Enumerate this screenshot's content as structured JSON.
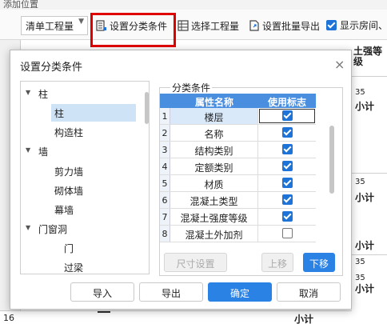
{
  "background": {
    "top_text": "添加位置",
    "toolbar": {
      "quantity_select": "清单工程量",
      "set_category_button": "设置分类条件",
      "choose_quantity_button": "选择工程量",
      "batch_export_button": "设置批量导出",
      "show_room_checkbox": "显示房间、"
    },
    "grid_right": {
      "header": "土强等级",
      "cells": [
        "35",
        "小计",
        "35",
        "小计",
        "35",
        "小计",
        "35",
        "小计"
      ]
    },
    "bottom_row": {
      "number": "16",
      "label": "小计"
    }
  },
  "dialog": {
    "title": "设置分类条件",
    "close": "×",
    "tree": [
      {
        "label": "柱",
        "level": 0,
        "expanded": true
      },
      {
        "label": "柱",
        "level": 1,
        "selected": true
      },
      {
        "label": "构造柱",
        "level": 1
      },
      {
        "label": "墙",
        "level": 0,
        "expanded": true
      },
      {
        "label": "剪力墙",
        "level": 1
      },
      {
        "label": "砌体墙",
        "level": 1
      },
      {
        "label": "幕墙",
        "level": 1
      },
      {
        "label": "门窗洞",
        "level": 0,
        "expanded": true
      },
      {
        "label": "门",
        "level": 1
      },
      {
        "label": "过梁",
        "level": 1
      }
    ],
    "group_label": "分类条件",
    "table": {
      "headers": {
        "name": "属性名称",
        "flag": "使用标志"
      },
      "rows": [
        {
          "num": "1",
          "name": "楼层",
          "checked": true,
          "selected": true
        },
        {
          "num": "2",
          "name": "名称",
          "checked": true
        },
        {
          "num": "3",
          "name": "结构类别",
          "checked": true
        },
        {
          "num": "4",
          "name": "定额类别",
          "checked": true
        },
        {
          "num": "5",
          "name": "材质",
          "checked": true
        },
        {
          "num": "6",
          "name": "混凝土类型",
          "checked": true
        },
        {
          "num": "7",
          "name": "混凝土强度等级",
          "checked": true
        },
        {
          "num": "8",
          "name": "混凝土外加剂",
          "checked": false
        }
      ]
    },
    "buttons": {
      "size_settings": "尺寸设置",
      "move_up": "上移",
      "move_down": "下移",
      "import": "导入",
      "export": "导出",
      "ok": "确定",
      "cancel": "取消"
    }
  }
}
